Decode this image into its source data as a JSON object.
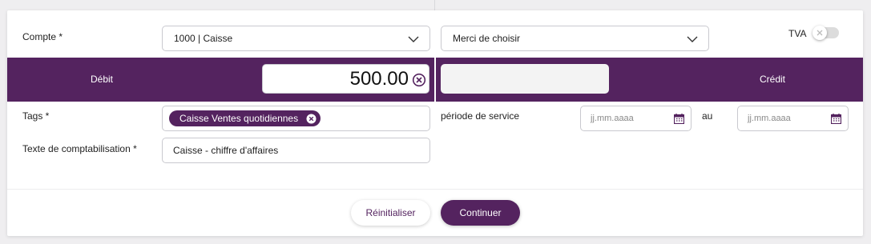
{
  "account": {
    "label": "Compte *",
    "selected": "1000 | Caisse",
    "second_select": "Merci de choisir"
  },
  "vat": {
    "label": "TVA",
    "enabled": false
  },
  "entry": {
    "debit_label": "Débit",
    "amount": "500.00",
    "credit_label": "Crédit",
    "credit_amount": ""
  },
  "tags": {
    "label": "Tags *",
    "items": [
      "Caisse Ventes quotidiennes"
    ]
  },
  "booking_text": {
    "label": "Texte de comptabilisation *",
    "value": "Caisse - chiffre d'affaires"
  },
  "service_period": {
    "label": "période de service",
    "from_placeholder": "jj.mm.aaaa",
    "separator": "au",
    "to_placeholder": "jj.mm.aaaa"
  },
  "actions": {
    "reset_label": "Réinitialiser",
    "continue_label": "Continuer"
  },
  "colors": {
    "accent": "#54235f",
    "border": "#c9c9cf"
  }
}
